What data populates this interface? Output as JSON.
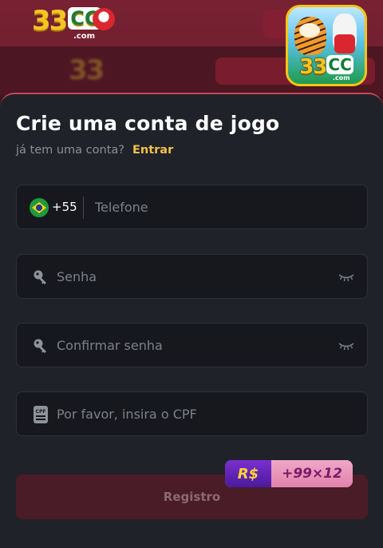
{
  "background": {
    "logo_main": "33",
    "logo_cc": "CC",
    "logo_com": ".com"
  },
  "app_icon": {
    "logo_main": "33",
    "logo_cc": "CC",
    "logo_com": ".com"
  },
  "form": {
    "title": "Crie uma conta de jogo",
    "subtitle": "já tem uma conta?",
    "login_link": "Entrar",
    "phone": {
      "country_code": "+55",
      "placeholder": "Telefone",
      "flag_icon": "brazil-flag-icon"
    },
    "password": {
      "placeholder": "Senha",
      "icon": "key-icon",
      "toggle_icon": "eye-closed-icon"
    },
    "confirm_password": {
      "placeholder": "Confirmar senha",
      "icon": "key-icon",
      "toggle_icon": "eye-closed-icon"
    },
    "cpf": {
      "placeholder": "Por favor, insira o CPF",
      "icon": "cpf-card-icon",
      "icon_text": "CPF"
    },
    "register_label": "Registro",
    "promo": {
      "currency": "R$",
      "amount": "+99×12"
    }
  },
  "colors": {
    "accent": "#f1c14a",
    "sheet_bg": "#1f2228",
    "field_bg": "#16181d",
    "button_bg": "#4a1c28"
  }
}
